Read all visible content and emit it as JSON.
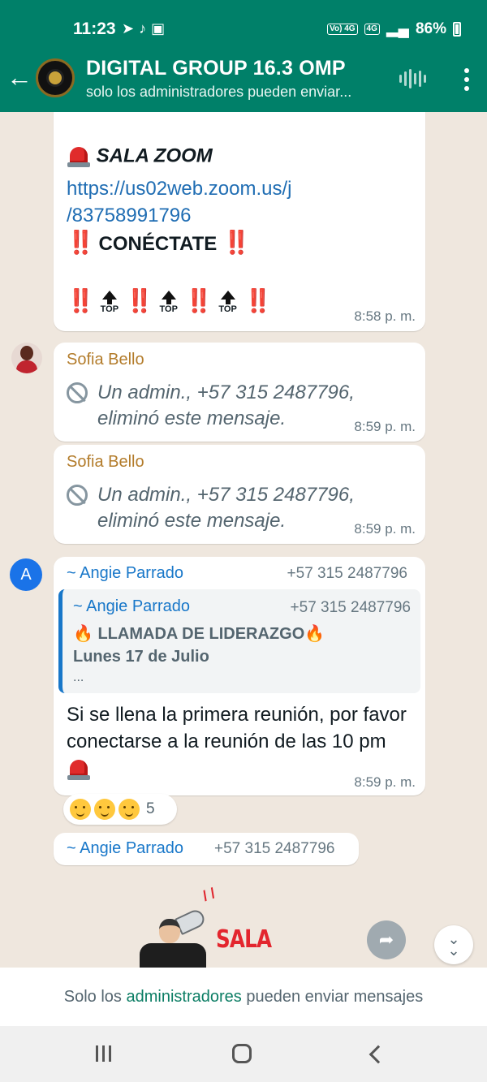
{
  "status_bar": {
    "time": "11:23",
    "battery": "86%",
    "net_badge_1": "Vo) 4G",
    "net_badge_2": "4G"
  },
  "header": {
    "group_name": "DIGITAL GROUP 16.3 OMP",
    "subtitle": "solo los administradores pueden enviar..."
  },
  "messages": {
    "zoom": {
      "title": "SALA ZOOM",
      "link_line_1": "https://us02web.zoom.us/j",
      "link_line_2": "/83758991796",
      "cta": "CONÉCTATE",
      "top_label": "TOP",
      "bangs": "‼️",
      "time": "8:58 p. m."
    },
    "deleted_1": {
      "sender": "Sofia Bello",
      "text": "Un admin., +57 315 2487796, eliminó este mensaje.",
      "time": "8:59 p. m."
    },
    "deleted_2": {
      "sender": "Sofia Bello",
      "text": "Un admin., +57 315 2487796, eliminó este mensaje.",
      "time": "8:59 p. m."
    },
    "reply": {
      "avatar_letter": "A",
      "sender": "~ Angie Parrado",
      "phone": "+57 315 2487796",
      "quoted_sender": "~ Angie Parrado",
      "quoted_phone": "+57 315 2487796",
      "quoted_line_1": "LLAMADA DE LIDERAZGO",
      "quoted_line_2": "Lunes 17 de Julio",
      "quoted_line_3": "...",
      "body": "Si se llena la primera reunión, por favor conectarse a la reunión de las 10 pm",
      "time": "8:59 p. m.",
      "reaction_count": "5"
    },
    "next": {
      "sender": "~ Angie Parrado",
      "phone": "+57 315 2487796",
      "sticker_text": "SALA"
    }
  },
  "footer": {
    "notice_prefix": "Solo los ",
    "notice_link": "administradores",
    "notice_suffix": " pueden enviar mensajes"
  },
  "icons": {
    "back": "arrow-left-icon",
    "voice": "audio-wave-icon",
    "menu": "more-vert-icon",
    "forward": "forward-icon",
    "scroll": "chevron-double-down-icon"
  },
  "colors": {
    "header": "#008069",
    "chat_bg": "#efe7de",
    "sender_sofia": "#b37c2b",
    "sender_angie": "#1877c9",
    "link": "#1f6db3"
  }
}
